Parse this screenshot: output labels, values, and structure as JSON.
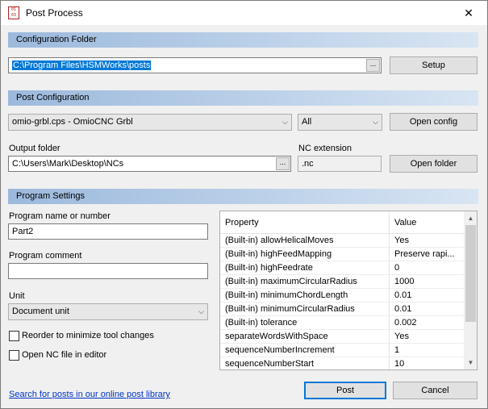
{
  "window": {
    "title": "Post Process",
    "app_icon_text": "01 03",
    "close_glyph": "✕"
  },
  "config_folder": {
    "header": "Configuration Folder",
    "path": "C:\\Program Files\\HSMWorks\\posts",
    "browse_label": "...",
    "setup_label": "Setup"
  },
  "post_config": {
    "header": "Post Configuration",
    "post_selected": "omio-grbl.cps - OmioCNC Grbl",
    "filter_selected": "All",
    "open_config_label": "Open config",
    "output_folder_label": "Output folder",
    "output_folder_value": "C:\\Users\\Mark\\Desktop\\NCs",
    "output_browse_label": "...",
    "nc_extension_label": "NC extension",
    "nc_extension_value": ".nc",
    "open_folder_label": "Open folder"
  },
  "program_settings": {
    "header": "Program Settings",
    "program_name_label": "Program name or number",
    "program_name_value": "Part2",
    "program_comment_label": "Program comment",
    "program_comment_value": "",
    "unit_label": "Unit",
    "unit_selected": "Document unit",
    "reorder_label": "Reorder to minimize tool changes",
    "reorder_checked": false,
    "open_nc_label": "Open NC file in editor",
    "open_nc_checked": false
  },
  "properties": {
    "col_property": "Property",
    "col_value": "Value",
    "rows": [
      {
        "property": "(Built-in) allowHelicalMoves",
        "value": "Yes"
      },
      {
        "property": "(Built-in) highFeedMapping",
        "value": "Preserve rapi..."
      },
      {
        "property": "(Built-in) highFeedrate",
        "value": "0"
      },
      {
        "property": "(Built-in) maximumCircularRadius",
        "value": "1000"
      },
      {
        "property": "(Built-in) minimumChordLength",
        "value": "0.01"
      },
      {
        "property": "(Built-in) minimumCircularRadius",
        "value": "0.01"
      },
      {
        "property": "(Built-in) tolerance",
        "value": "0.002"
      },
      {
        "property": "separateWordsWithSpace",
        "value": "Yes"
      },
      {
        "property": "sequenceNumberIncrement",
        "value": "1"
      },
      {
        "property": "sequenceNumberStart",
        "value": "10"
      }
    ]
  },
  "footer": {
    "search_link": "Search for posts in our online post library",
    "post_label": "Post",
    "cancel_label": "Cancel"
  },
  "icons": {
    "dropdown": "chevron-down-icon",
    "scroll_up": "arrow-up-icon",
    "scroll_down": "arrow-down-icon"
  }
}
